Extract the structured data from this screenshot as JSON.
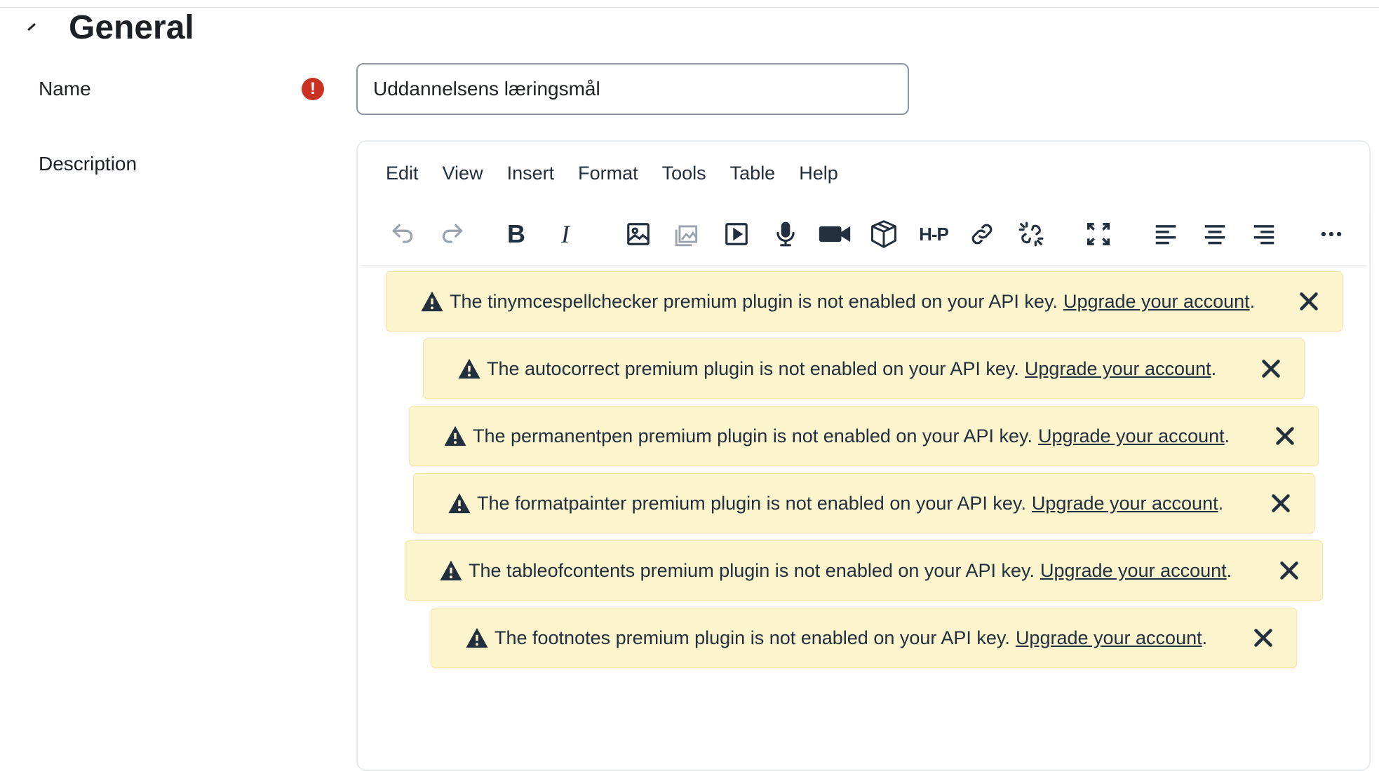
{
  "section": {
    "title": "General"
  },
  "form": {
    "name_label": "Name",
    "required_symbol": "!",
    "name_value": "Uddannelsens læringsmål",
    "description_label": "Description"
  },
  "editor": {
    "menu": [
      "Edit",
      "View",
      "Insert",
      "Format",
      "Tools",
      "Table",
      "Help"
    ],
    "toolbar_icons": [
      "undo-icon",
      "redo-icon",
      "bold-icon",
      "italic-icon",
      "image-icon",
      "media-manager-icon",
      "video-icon",
      "audio-record-icon",
      "video-record-icon",
      "h5p-block-icon",
      "h5p-icon",
      "link-icon",
      "unlink-icon",
      "fullscreen-icon",
      "align-left-icon",
      "align-center-icon",
      "align-right-icon",
      "more-icon"
    ],
    "h5p_label": "H-P",
    "bold_label": "B",
    "italic_label": "I",
    "notifications": [
      {
        "message": "The tinymcespellchecker premium plugin is not enabled on your API key.",
        "link": "Upgrade your account",
        "end": "."
      },
      {
        "message": "The autocorrect premium plugin is not enabled on your API key.",
        "link": "Upgrade your account",
        "end": "."
      },
      {
        "message": "The permanentpen premium plugin is not enabled on your API key.",
        "link": "Upgrade your account",
        "end": "."
      },
      {
        "message": "The formatpainter premium plugin is not enabled on your API key.",
        "link": "Upgrade your account",
        "end": "."
      },
      {
        "message": "The tableofcontents premium plugin is not enabled on your API key.",
        "link": "Upgrade your account",
        "end": "."
      },
      {
        "message": "The footnotes premium plugin is not enabled on your API key.",
        "link": "Upgrade your account",
        "end": "."
      }
    ]
  },
  "colors": {
    "notice_bg": "#fcf4cc",
    "required": "#ca3120",
    "text": "#1d2125"
  }
}
